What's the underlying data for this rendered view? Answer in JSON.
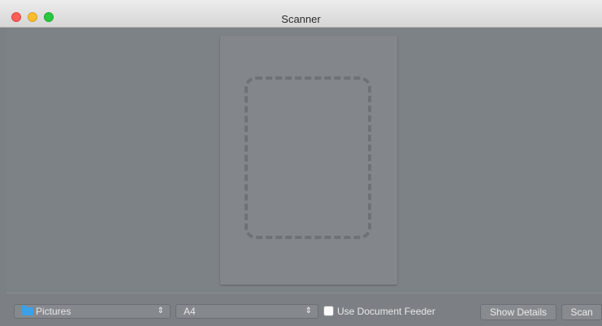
{
  "window": {
    "title": "Scanner"
  },
  "controls": {
    "destination": {
      "value": "Pictures",
      "icon": "folder-icon",
      "icon_color": "#3aa0e8"
    },
    "paper_size": {
      "value": "A4"
    },
    "stepper_glyph": "⇕",
    "document_feeder": {
      "label": "Use Document Feeder",
      "checked": false
    },
    "show_details_label": "Show Details",
    "scan_label": "Scan"
  },
  "colors": {
    "close": "#fe5f57",
    "minimize": "#febc2e",
    "zoom": "#28c840"
  }
}
